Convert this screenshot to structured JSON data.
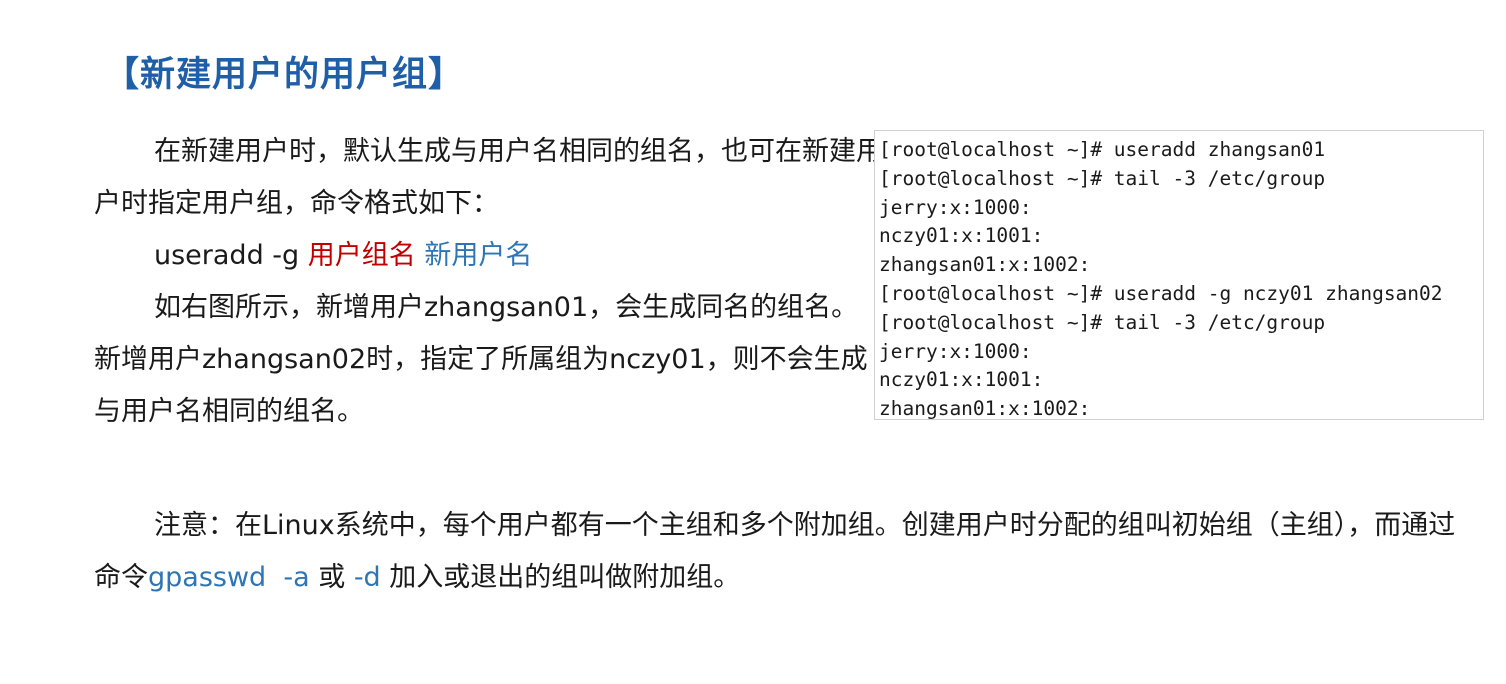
{
  "title": "【新建用户的用户组】",
  "intro": {
    "line1": "在新建用户时，默认生成与用户名相同的组名，也可在新建用户时指定用户组，命令格式如下：",
    "command": {
      "prefix": "useradd -g ",
      "group_placeholder": "用户组名",
      "space": " ",
      "user_placeholder": "新用户名"
    },
    "line3": "如右图所示，新增用户zhangsan01，会生成同名的组名。新增用户zhangsan02时，指定了所属组为nczy01，则不会生成与用户名相同的组名。"
  },
  "terminal": {
    "lines": [
      "[root@localhost ~]# useradd zhangsan01",
      "[root@localhost ~]# tail -3 /etc/group",
      "jerry:x:1000:",
      "nczy01:x:1001:",
      "zhangsan01:x:1002:",
      "[root@localhost ~]# useradd -g nczy01 zhangsan02",
      "[root@localhost ~]# tail -3 /etc/group",
      "jerry:x:1000:",
      "nczy01:x:1001:",
      "zhangsan01:x:1002:"
    ]
  },
  "note": {
    "part1": "注意：在Linux系统中，每个用户都有一个主组和多个附加组。创建用户时分配的组叫初始组（主组），而通过命令",
    "cmd1": "gpasswd  -a",
    "or": " 或 ",
    "cmd2": "-d",
    "part2": " 加入或退出的组叫做附加组。"
  },
  "colors": {
    "title": "#1f5fa8",
    "placeholder_red": "#c00000",
    "placeholder_blue": "#2e75b6"
  }
}
